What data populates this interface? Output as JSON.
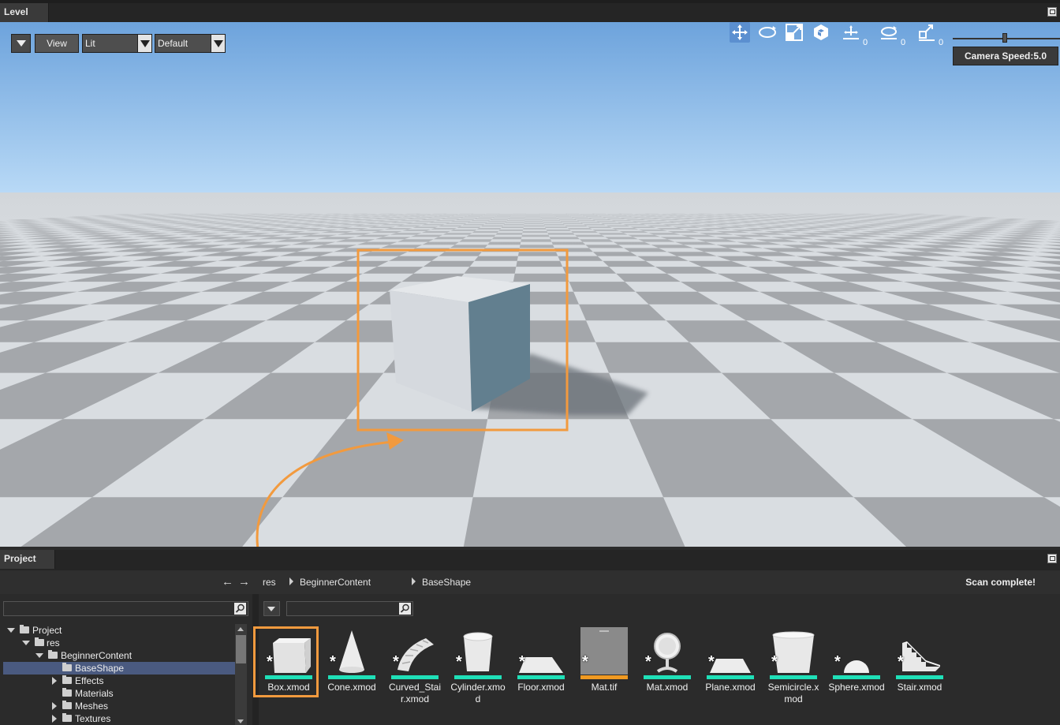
{
  "level_panel": {
    "tab_label": "Level",
    "toolbar": {
      "view_label": "View",
      "lighting_mode": "Lit",
      "camera_preset": "Default",
      "translate_count": "0",
      "rotate_count": "0",
      "scale_count": "0",
      "camera_speed": "Camera Speed:5.0"
    }
  },
  "project_panel": {
    "tab_label": "Project",
    "breadcrumb": [
      "res",
      "BeginnerContent",
      "BaseShape"
    ],
    "status": "Scan complete!",
    "tree": [
      {
        "label": "Project",
        "depth": 0,
        "expanded": true
      },
      {
        "label": "res",
        "depth": 1,
        "expanded": true
      },
      {
        "label": "BeginnerContent",
        "depth": 2,
        "expanded": true
      },
      {
        "label": "BaseShape",
        "depth": 3,
        "selected": true
      },
      {
        "label": "Effects",
        "depth": 3,
        "expanded": false
      },
      {
        "label": "Materials",
        "depth": 3
      },
      {
        "label": "Meshes",
        "depth": 3,
        "expanded": false
      },
      {
        "label": "Textures",
        "depth": 3,
        "expanded": false
      }
    ],
    "assets": [
      {
        "label": "Box.xmod",
        "icon": "box-icon",
        "type_color": "#1fe0b8"
      },
      {
        "label": "Cone.xmod",
        "icon": "cone-icon",
        "type_color": "#1fe0b8"
      },
      {
        "label": "Curved_Stair.xmod",
        "icon": "curved-stair-icon",
        "type_color": "#1fe0b8"
      },
      {
        "label": "Cylinder.xmod",
        "icon": "cylinder-icon",
        "type_color": "#1fe0b8"
      },
      {
        "label": "Floor.xmod",
        "icon": "floor-icon",
        "type_color": "#1fe0b8"
      },
      {
        "label": "Mat.tif",
        "icon": "texture-icon",
        "type_color": "#f09a22"
      },
      {
        "label": "Mat.xmod",
        "icon": "mat-icon",
        "type_color": "#1fe0b8"
      },
      {
        "label": "Plane.xmod",
        "icon": "plane-icon",
        "type_color": "#1fe0b8"
      },
      {
        "label": "Semicircle.xmod",
        "icon": "semicircle-icon",
        "type_color": "#1fe0b8"
      },
      {
        "label": "Sphere.xmod",
        "icon": "sphere-icon",
        "type_color": "#1fe0b8"
      },
      {
        "label": "Stair.xmod",
        "icon": "stair-icon",
        "type_color": "#1fe0b8"
      }
    ]
  },
  "colors": {
    "highlight": "#f29a3e",
    "mesh_tag": "#1fe0b8",
    "texture_tag": "#f09a22",
    "selection": "#4a5a80"
  }
}
